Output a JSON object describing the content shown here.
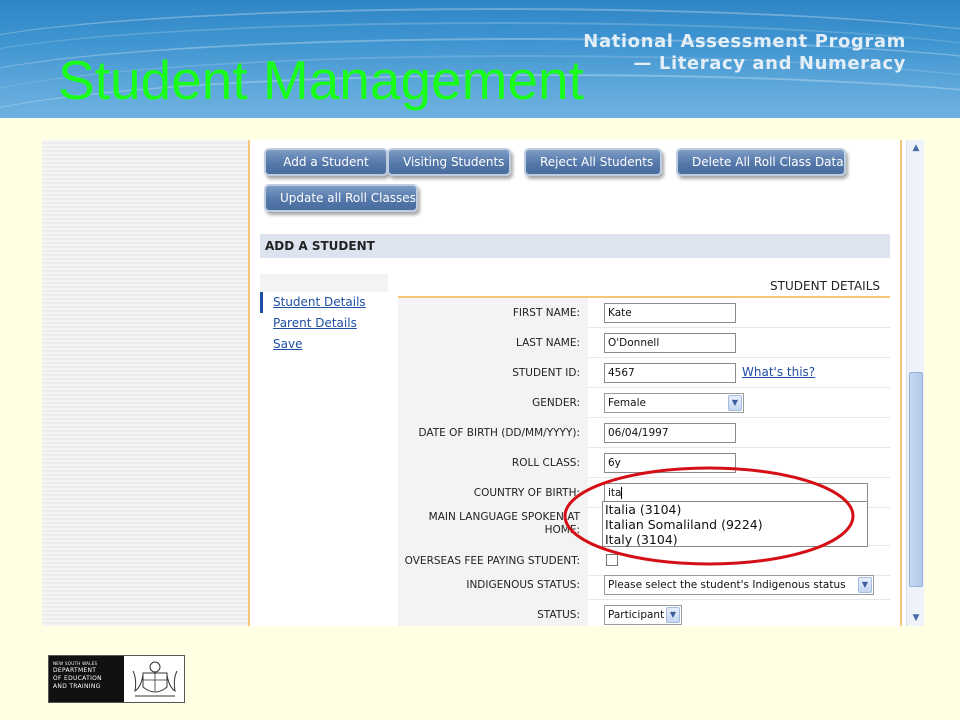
{
  "banner": {
    "program_line1": "National Assessment Program",
    "program_line2": "— Literacy and Numeracy"
  },
  "slide_title": "Student Management",
  "toolbar": {
    "add_student": "Add a Student",
    "visiting_students": "Visiting Students",
    "reject_all": "Reject All Students",
    "delete_all_roll": "Delete All Roll Class Data",
    "update_roll_classes": "Update all Roll Classes"
  },
  "section_title": "ADD A STUDENT",
  "nav": {
    "student_details": "Student Details",
    "parent_details": "Parent Details",
    "save": "Save"
  },
  "details_title": "STUDENT DETAILS",
  "form": {
    "first_name": {
      "label": "FIRST NAME:",
      "value": "Kate"
    },
    "last_name": {
      "label": "LAST NAME:",
      "value": "O'Donnell"
    },
    "student_id": {
      "label": "STUDENT ID:",
      "value": "4567",
      "help": "What's this?"
    },
    "gender": {
      "label": "GENDER:",
      "value": "Female"
    },
    "dob": {
      "label": "DATE OF BIRTH (DD/MM/YYYY):",
      "value": "06/04/1997"
    },
    "roll_class": {
      "label": "ROLL CLASS:",
      "value": "6y"
    },
    "country": {
      "label": "COUNTRY OF BIRTH:",
      "value": "ita"
    },
    "language": {
      "label_line1": "MAIN LANGUAGE SPOKEN AT",
      "label_line2": "HOME:"
    },
    "overseas": {
      "label": "OVERSEAS FEE PAYING STUDENT:"
    },
    "indigenous": {
      "label": "INDIGENOUS STATUS:",
      "value": "Please select the student's Indigenous status"
    },
    "status": {
      "label": "STATUS:",
      "value": "Participant"
    }
  },
  "autocomplete": [
    "Italia (3104)",
    "Italian Somaliland (9224)",
    "Italy (3104)"
  ],
  "footer_logo": {
    "line1": "NEW SOUTH WALES",
    "line2": "DEPARTMENT",
    "line3": "OF EDUCATION",
    "line4": "AND TRAINING"
  },
  "colors": {
    "title_green": "#1aff1a",
    "button_blue": "#5578ab",
    "link_blue": "#1f4fa3",
    "annotation_red": "#d40f16",
    "slide_background": "#ffffe4"
  }
}
